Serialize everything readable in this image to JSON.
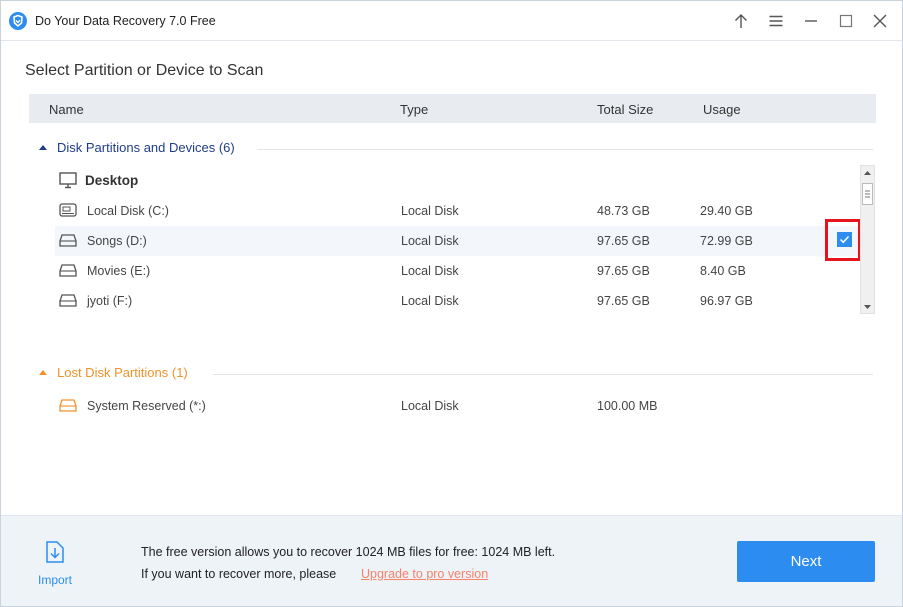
{
  "window": {
    "title": "Do Your Data Recovery 7.0 Free"
  },
  "heading": "Select Partition or Device to Scan",
  "columns": {
    "name": "Name",
    "type": "Type",
    "total_size": "Total Size",
    "usage": "Usage"
  },
  "groups": {
    "disk": {
      "title": "Disk Partitions and Devices (6)",
      "color": "#1f3d8a"
    },
    "lost": {
      "title": "Lost Disk Partitions (1)",
      "color": "#f0922a"
    }
  },
  "desktop_label": "Desktop",
  "rows": [
    {
      "name": "Local Disk (C:)",
      "type": "Local Disk",
      "size": "48.73 GB",
      "usage": "29.40 GB",
      "icon": "system-drive-icon"
    },
    {
      "name": "Songs (D:)",
      "type": "Local Disk",
      "size": "97.65 GB",
      "usage": "72.99 GB",
      "icon": "drive-icon",
      "checked": true
    },
    {
      "name": "Movies (E:)",
      "type": "Local Disk",
      "size": "97.65 GB",
      "usage": "8.40 GB",
      "icon": "drive-icon"
    },
    {
      "name": "jyoti (F:)",
      "type": "Local Disk",
      "size": "97.65 GB",
      "usage": "96.97 GB",
      "icon": "drive-icon"
    }
  ],
  "lost_rows": [
    {
      "name": "System Reserved (*:)",
      "type": "Local Disk",
      "size": "100.00 MB",
      "usage": "",
      "icon": "lost-drive-icon"
    }
  ],
  "footer": {
    "import_label": "Import",
    "note_line1": "The free version allows you to recover 1024 MB files for free: 1024 MB left.",
    "note_line2": "If you want to recover more, please",
    "upgrade_link": "Upgrade to pro version",
    "next_label": "Next"
  },
  "colors": {
    "accent": "#2d8cf0",
    "highlight": "#e8141d",
    "upgrade": "#f5826a"
  }
}
